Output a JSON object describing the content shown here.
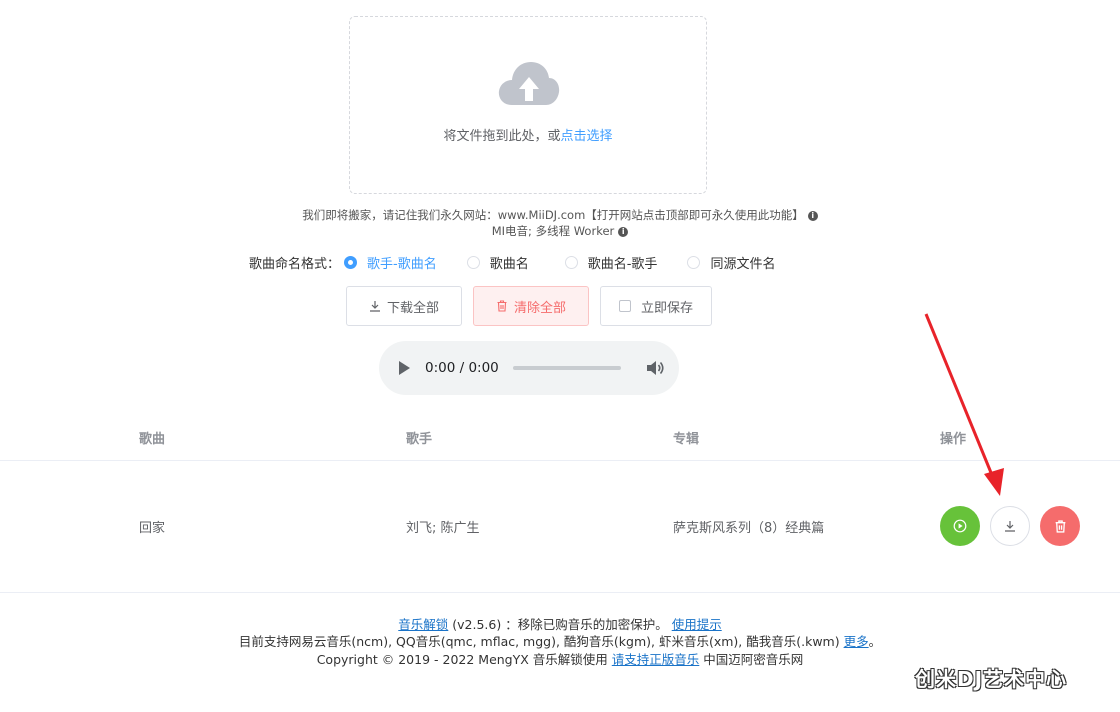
{
  "upload": {
    "hint_prefix": "将文件拖到此处，或",
    "hint_link": "点击选择"
  },
  "notice": {
    "line1": "我们即将搬家，请记住我们永久网站：www.MiiDJ.com【打开网站点击顶部即可永久使用此功能】",
    "line2": "MI电音; 多线程 Worker"
  },
  "naming": {
    "label": "歌曲命名格式：",
    "options": [
      "歌手-歌曲名",
      "歌曲名",
      "歌曲名-歌手",
      "同源文件名"
    ],
    "selected": "歌手-歌曲名"
  },
  "buttons": {
    "download_all": "下载全部",
    "clear_all": "清除全部",
    "save_now": "立即保存"
  },
  "audio": {
    "time": "0:00 / 0:00"
  },
  "table": {
    "headers": [
      "歌曲",
      "歌手",
      "专辑",
      "操作"
    ],
    "rows": [
      {
        "song": "回家",
        "artist": "刘飞; 陈广生",
        "album": "萨克斯风系列（8）经典篇"
      }
    ]
  },
  "footer": {
    "name_link": "音乐解锁",
    "version_text": "(v2.5.6) ：移除已购音乐的加密保护。",
    "help_link": "使用提示",
    "support_text": "目前支持网易云音乐(ncm), QQ音乐(qmc, mflac, mgg), 酷狗音乐(kgm), 虾米音乐(xm), 酷我音乐(.kwm)",
    "more_link": "更多",
    "support_end": "。",
    "copyright_text": "Copyright © 2019 - 2022 MengYX 音乐解锁使用",
    "genuine_link": "请支持正版音乐",
    "site_text": "中国迈阿密音乐网"
  },
  "watermark": "创米DJ艺术中心",
  "colors": {
    "primary": "#409eff",
    "success": "#67c23a",
    "danger": "#f56c6c",
    "arrow": "#e8232a"
  },
  "icons": {
    "upload": "cloud-upload-icon",
    "info": "info-icon",
    "download": "download-icon",
    "delete": "trash-icon",
    "play": "play-icon",
    "volume": "volume-icon"
  }
}
